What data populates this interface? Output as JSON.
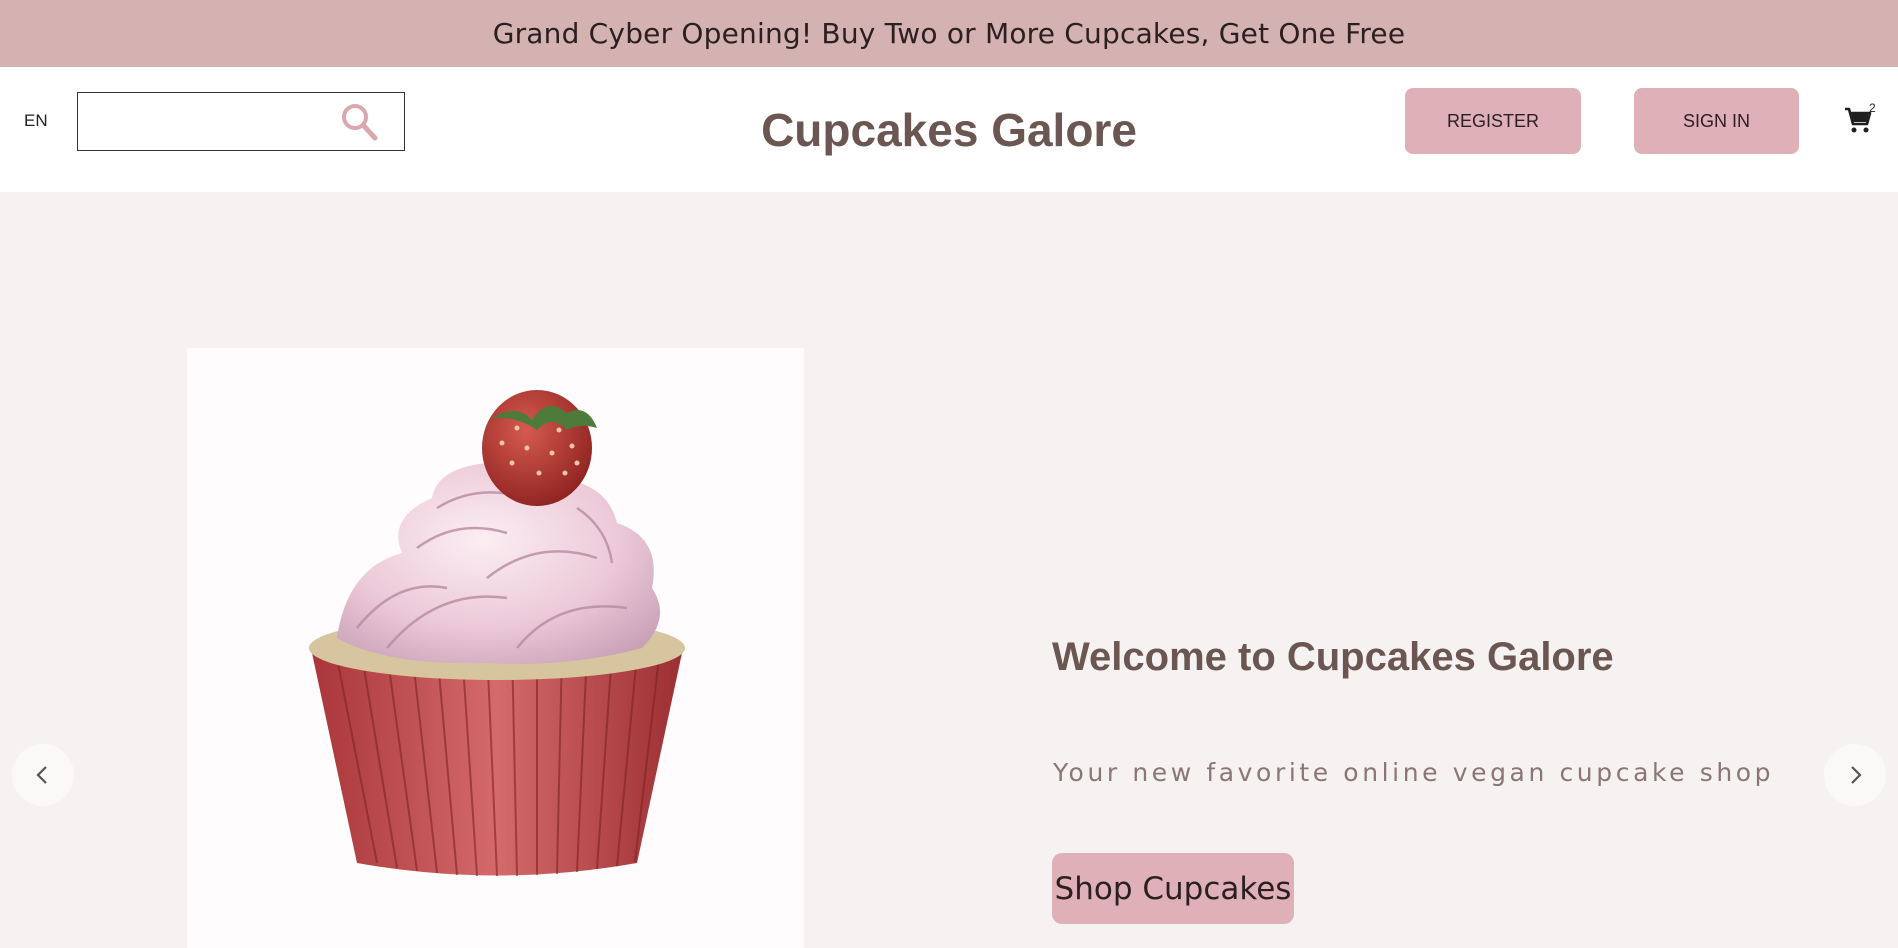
{
  "promo": {
    "text": "Grand Cyber Opening! Buy Two or More Cupcakes, Get One Free"
  },
  "header": {
    "language": "EN",
    "search": {
      "value": "",
      "placeholder": "",
      "icon": "search-icon"
    },
    "logo": "Cupcakes Galore",
    "register_label": "REGISTER",
    "signin_label": "SIGN IN",
    "cart": {
      "icon": "cart-icon",
      "count": "2"
    }
  },
  "hero": {
    "image": "cupcake-with-strawberry",
    "title": "Welcome to Cupcakes Galore",
    "tagline": "Your new favorite online vegan cupcake shop",
    "cta_label": "Shop Cupcakes",
    "prev_icon": "chevron-left-icon",
    "next_icon": "chevron-right-icon"
  },
  "colors": {
    "promo_bg": "#d4b2b1",
    "accent_button": "#dfb0b7",
    "heading": "#6b5651",
    "page_bg": "#f6f2f1"
  }
}
